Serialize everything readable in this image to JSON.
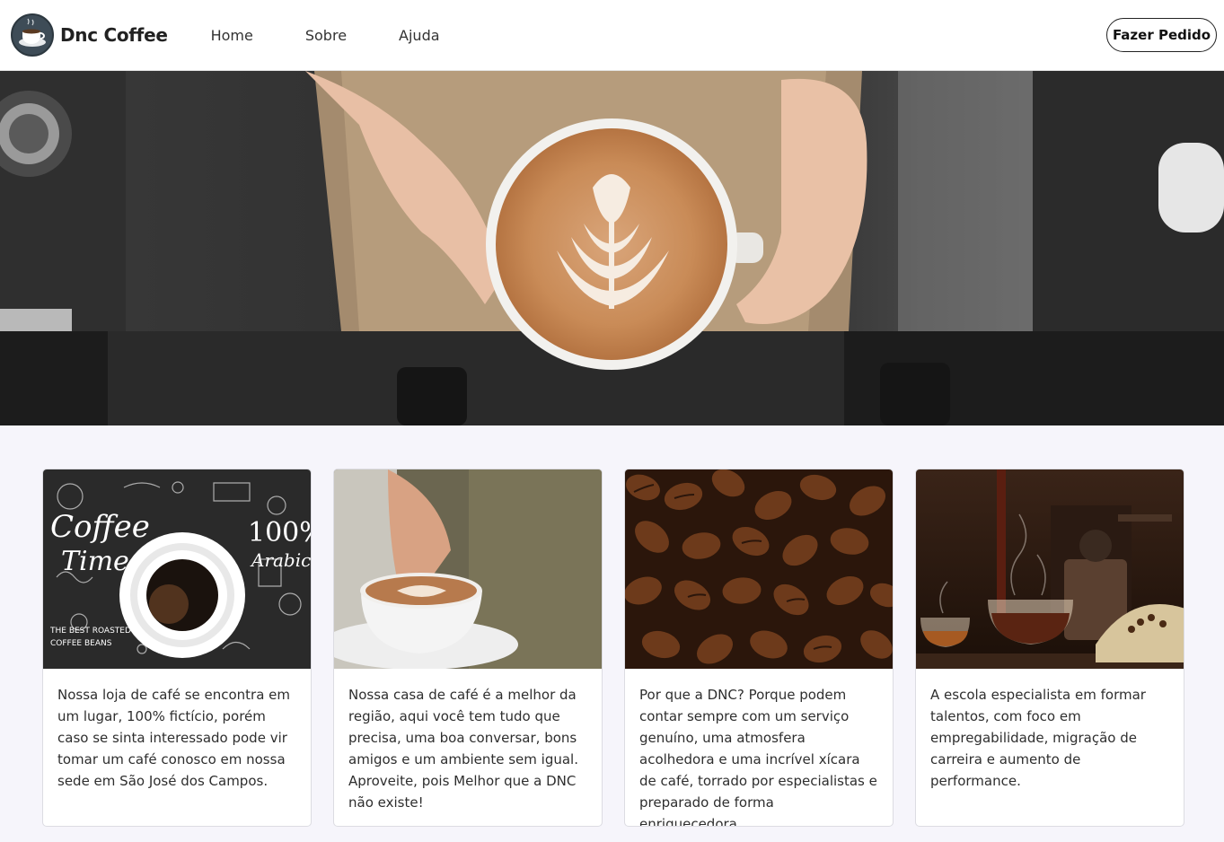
{
  "app": {
    "brand_name": "Dnc Coffee",
    "logo_icon": "coffee-cup-icon"
  },
  "nav": {
    "links": [
      "Home",
      "Sobre",
      "Ajuda"
    ],
    "order_button": "Fazer Pedido"
  },
  "hero": {
    "image": "latte-art-cup-held-by-barista"
  },
  "cards": [
    {
      "image": "coffee-time-illustration",
      "text": "Nossa loja de café se encontra em um lugar, 100% fictício, porém caso se sinta interessado pode vir tomar um café conosco em nossa sede em São José dos Campos."
    },
    {
      "image": "cappuccino-cup-saucer",
      "text": "Nossa casa de café é a melhor da região, aqui você tem tudo que precisa, uma boa conversar, bons amigos e um ambiente sem igual. Aproveite, pois Melhor que a DNC não existe!"
    },
    {
      "image": "roasted-coffee-beans",
      "text": "Por que a DNC? Porque podem contar sempre com um serviço genuíno, uma atmosfera acolhedora e uma incrível xícara de café, torrado por especialistas e preparado de forma enriquecedora."
    },
    {
      "image": "coffee-pouring-grinder",
      "text": "A escola especialista em formar talentos, com foco em empregabilidade, migração de carreira e aumento de performance."
    }
  ],
  "colors": {
    "background": "#f6f5fb",
    "navbar": "#ffffff",
    "text": "#2b2b2b"
  }
}
